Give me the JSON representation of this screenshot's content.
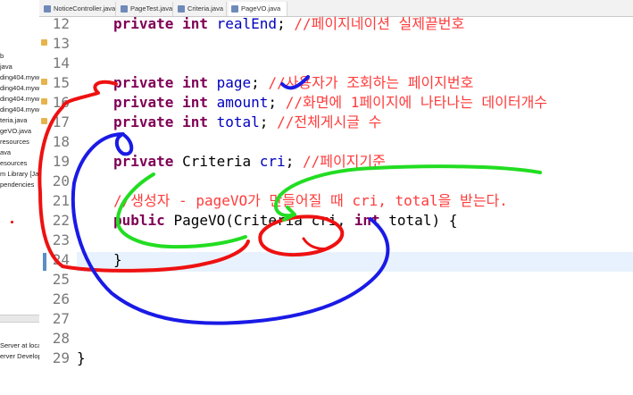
{
  "tabs": [
    {
      "label": "NoticeController.java"
    },
    {
      "label": "PageTest.java"
    },
    {
      "label": "Criteria.java"
    },
    {
      "label": "PageVO.java"
    }
  ],
  "explorer": {
    "items": [
      "b",
      "java",
      "ding404.myw",
      "ding404.myw",
      "ding404.myw",
      "ding404.myw",
      "teria.java",
      "geVO.java",
      "resources",
      "ava",
      "esources",
      "m Library [Java",
      "pendencies"
    ],
    "bottom_items": [
      "Server at local",
      "erver Develope"
    ]
  },
  "editor": {
    "line_numbers": [
      "12",
      "13",
      "14",
      "15",
      "16",
      "17",
      "18",
      "19",
      "20",
      "21",
      "22",
      "23",
      "24",
      "25",
      "26",
      "27",
      "28",
      "29"
    ],
    "lines": {
      "l12": {
        "kw1": "private",
        "kw2": "int",
        "field": "realEnd",
        "sep": ";",
        "comment": "//페이지네이션 실제끝번호"
      },
      "l14": {
        "kw1": "private",
        "kw2": "int",
        "field": "page",
        "sep": ";",
        "comment": "//사용자가 조회하는 페이지번호"
      },
      "l15": {
        "kw1": "private",
        "kw2": "int",
        "field": "amount",
        "sep": ";",
        "comment": "//화면에 1페이지에 나타나는 데이터개수"
      },
      "l16": {
        "kw1": "private",
        "kw2": "int",
        "field": "total",
        "sep": ";",
        "comment": "//전체게시글 수"
      },
      "l18": {
        "kw1": "private",
        "type": "Criteria",
        "field": "cri",
        "sep": ";",
        "comment": "//페이지기준"
      },
      "l20": {
        "comment": "//생성자 - pageVO가 만들어질 때 cri, total을 받는다."
      },
      "l21": {
        "kw1": "public",
        "rest": "PageVO(Criteria cri,",
        "kw2": "int",
        "rest2": "total) {"
      },
      "l23": {
        "text": "}"
      },
      "l28": {
        "text": "}"
      }
    }
  },
  "colors": {
    "keyword": "#7f0055",
    "field": "#0000c0",
    "comment": "#ff3b3b",
    "ink_red": "#ee1111",
    "ink_blue": "#1a1ae6",
    "ink_green": "#22dd22"
  }
}
